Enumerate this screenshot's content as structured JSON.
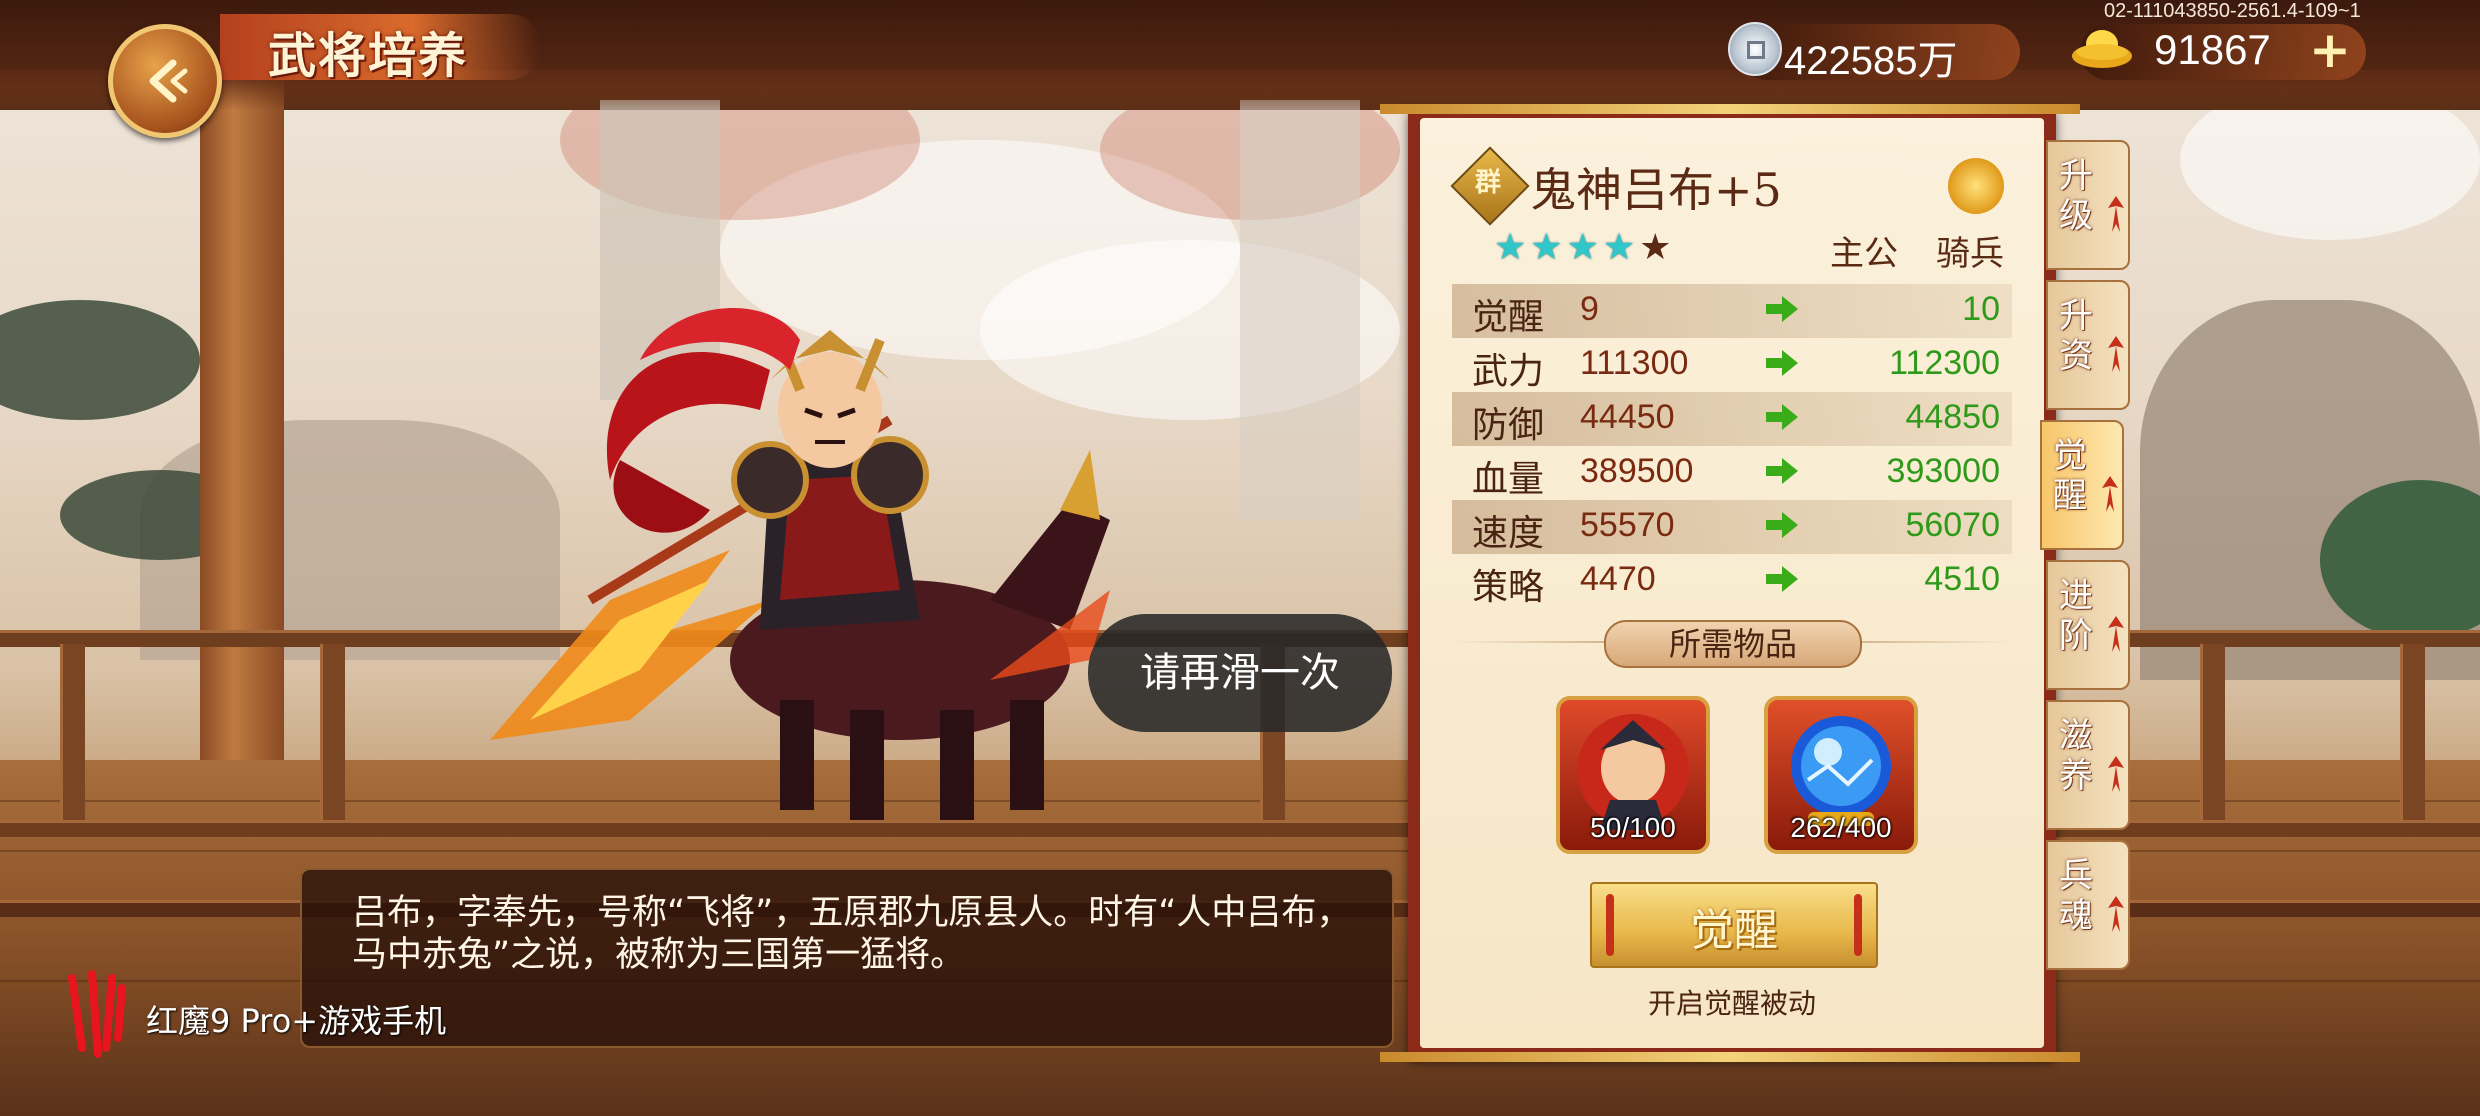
{
  "header": {
    "title": "武将培养",
    "silver_amount": "422585万",
    "gold_amount": "91867",
    "add_label": "+",
    "build_id": "02-111043850-2561.4-109~1"
  },
  "hero": {
    "badge": "群",
    "name": "鬼神吕布+5",
    "stars_filled": 4,
    "stars_total": 5,
    "tag_lord": "主公",
    "tag_cavalry": "骑兵",
    "bio": "吕布，字奉先，号称“飞将”，五原郡九原县人。时有“人中吕布，马中赤兔”之说，被称为三国第一猛将。"
  },
  "stats": [
    {
      "label": "觉醒",
      "current": "9",
      "next": "10"
    },
    {
      "label": "武力",
      "current": "111300",
      "next": "112300"
    },
    {
      "label": "防御",
      "current": "44450",
      "next": "44850"
    },
    {
      "label": "血量",
      "current": "389500",
      "next": "393000"
    },
    {
      "label": "速度",
      "current": "55570",
      "next": "56070"
    },
    {
      "label": "策略",
      "current": "4470",
      "next": "4510"
    }
  ],
  "items_header": "所需物品",
  "items": [
    {
      "count": "50/100",
      "icon": "hero-shard-icon"
    },
    {
      "count": "262/400",
      "icon": "blue-orb-icon"
    }
  ],
  "awaken_button": "觉醒",
  "awaken_hint": "开启觉醒被动",
  "side_tabs": [
    {
      "label": "升级",
      "active": false
    },
    {
      "label": "升资",
      "active": false
    },
    {
      "label": "觉醒",
      "active": true
    },
    {
      "label": "进阶",
      "active": false
    },
    {
      "label": "滋养",
      "active": false
    },
    {
      "label": "兵魂",
      "active": false
    }
  ],
  "toast": "请再滑一次",
  "brand": "红魔9 Pro+游戏手机",
  "colors": {
    "stat_current": "#7a2a10",
    "stat_next": "#2f9a1a",
    "star_on": "#2fc7c9",
    "panel_frame": "#8c2a1a"
  }
}
